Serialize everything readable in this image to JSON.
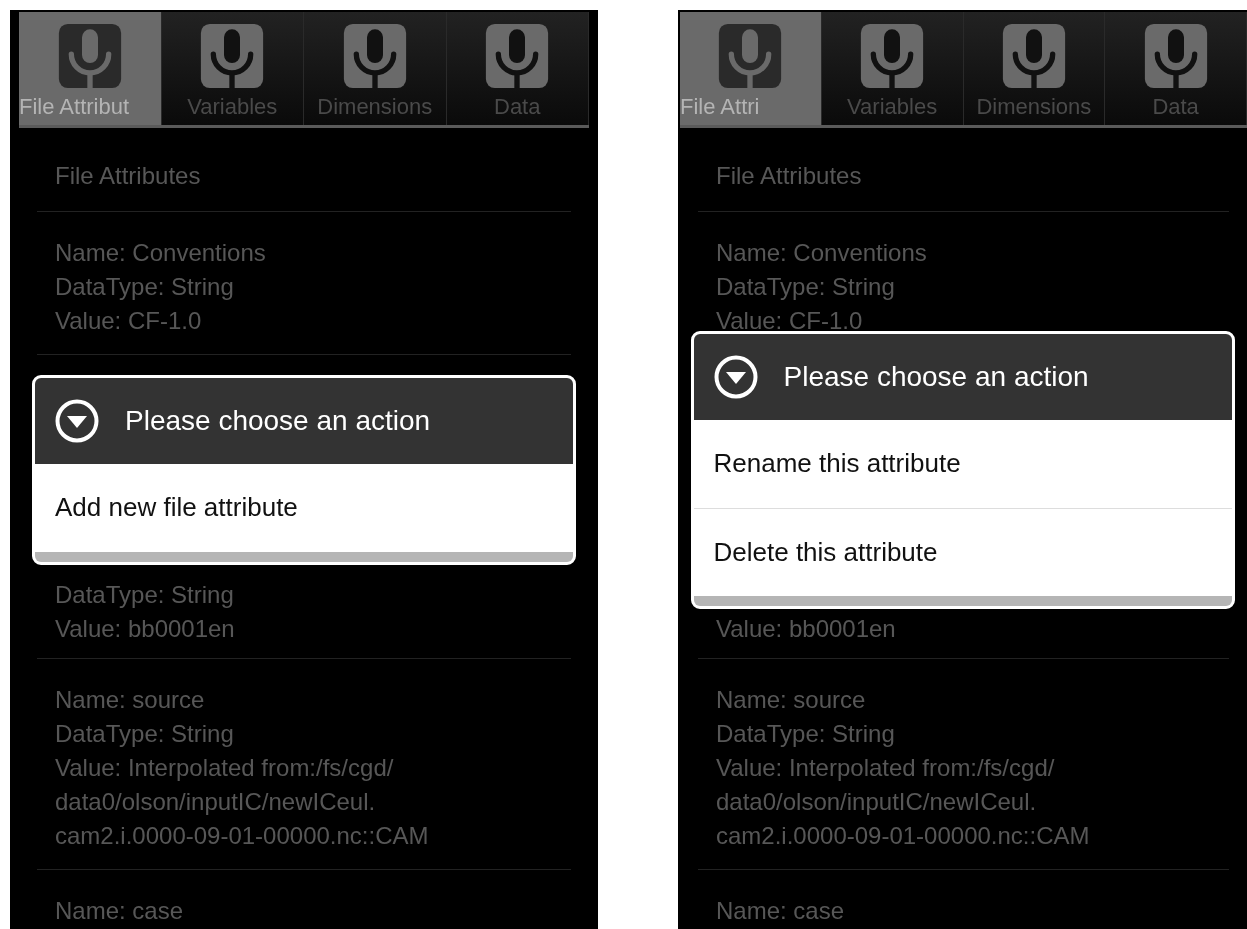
{
  "screens": [
    {
      "tabs": [
        {
          "label": "File Attribut",
          "selected": true
        },
        {
          "label": "Variables",
          "selected": false
        },
        {
          "label": "Dimensions",
          "selected": false
        },
        {
          "label": "Data",
          "selected": false
        }
      ],
      "header": "File Attributes",
      "entries": [
        {
          "lines": [
            "Name: Conventions",
            "DataType: String",
            "Value: CF-1.0"
          ]
        },
        {
          "lines": [
            "DataType: String",
            "Value: bb0001en"
          ]
        },
        {
          "lines": [
            "Name: source",
            "DataType: String",
            "Value: Interpolated from:/fs/cgd/",
            "data0/olson/inputIC/newICeul.",
            "cam2.i.0000-09-01-00000.nc::CAM"
          ]
        },
        {
          "lines": [
            "Name: case"
          ]
        }
      ],
      "dialog": {
        "title": "Please choose an action",
        "items": [
          "Add new file attribute"
        ]
      }
    },
    {
      "tabs": [
        {
          "label": "File Attri",
          "selected": true
        },
        {
          "label": "Variables",
          "selected": false
        },
        {
          "label": "Dimensions",
          "selected": false
        },
        {
          "label": "Data",
          "selected": false
        }
      ],
      "header": "File Attributes",
      "entries": [
        {
          "lines": [
            "Name: Conventions",
            "DataType: String",
            "Value: CF-1.0"
          ]
        },
        {
          "lines": [
            "Value: bb0001en"
          ]
        },
        {
          "lines": [
            "Name: source",
            "DataType: String",
            "Value: Interpolated from:/fs/cgd/",
            "data0/olson/inputIC/newICeul.",
            "cam2.i.0000-09-01-00000.nc::CAM"
          ]
        },
        {
          "lines": [
            "Name: case"
          ]
        }
      ],
      "dialog": {
        "title": "Please choose an action",
        "items": [
          "Rename this attribute",
          "Delete this attribute"
        ]
      }
    }
  ]
}
